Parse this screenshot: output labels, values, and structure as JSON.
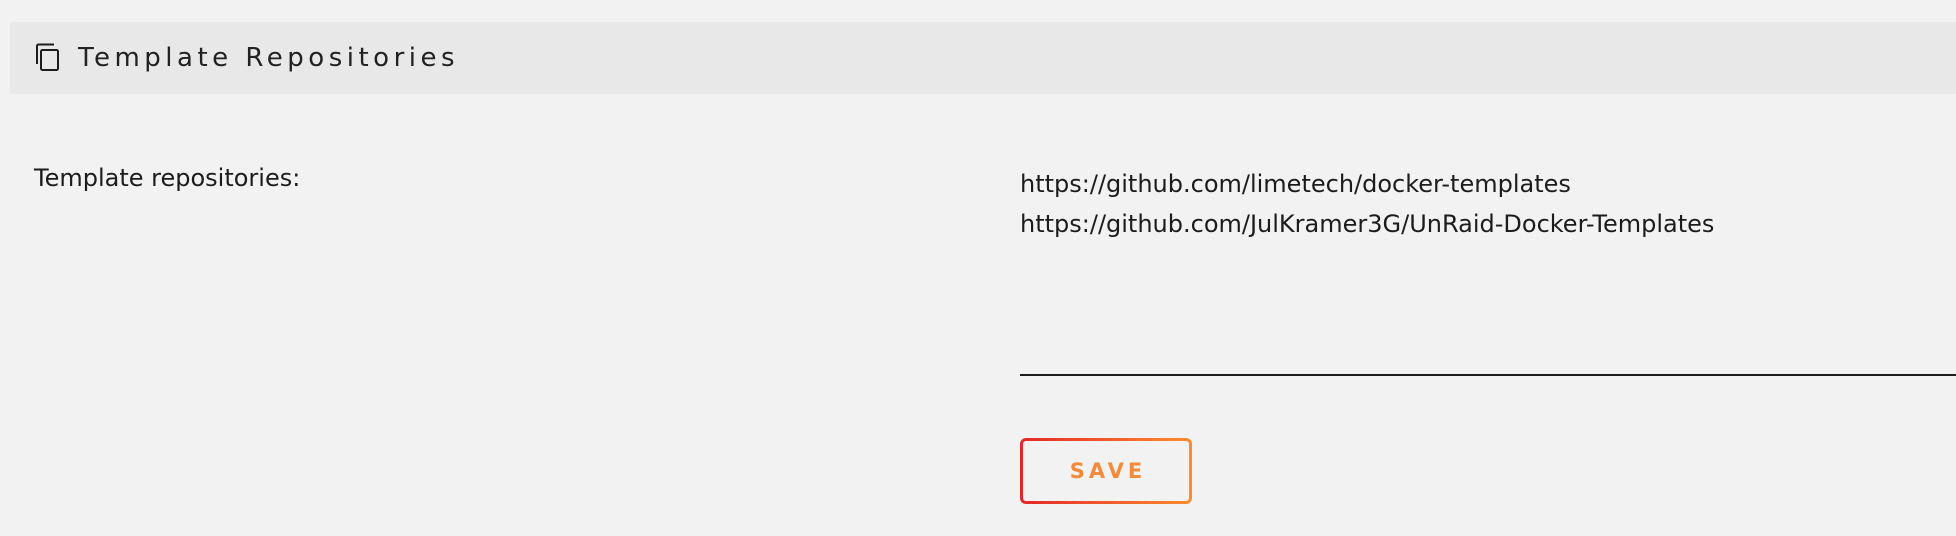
{
  "header": {
    "title": "Template Repositories",
    "icon": "copy-icon"
  },
  "form": {
    "label": "Template repositories:",
    "repositories_value": "https://github.com/limetech/docker-templates\nhttps://github.com/JulKramer3G/UnRaid-Docker-Templates",
    "save_label": "SAVE"
  },
  "colors": {
    "background": "#f2f2f2",
    "header_background": "#e8e8e8",
    "button_gradient_start": "#e22828",
    "button_gradient_end": "#ff8c2f",
    "button_text": "#f68a3a"
  }
}
